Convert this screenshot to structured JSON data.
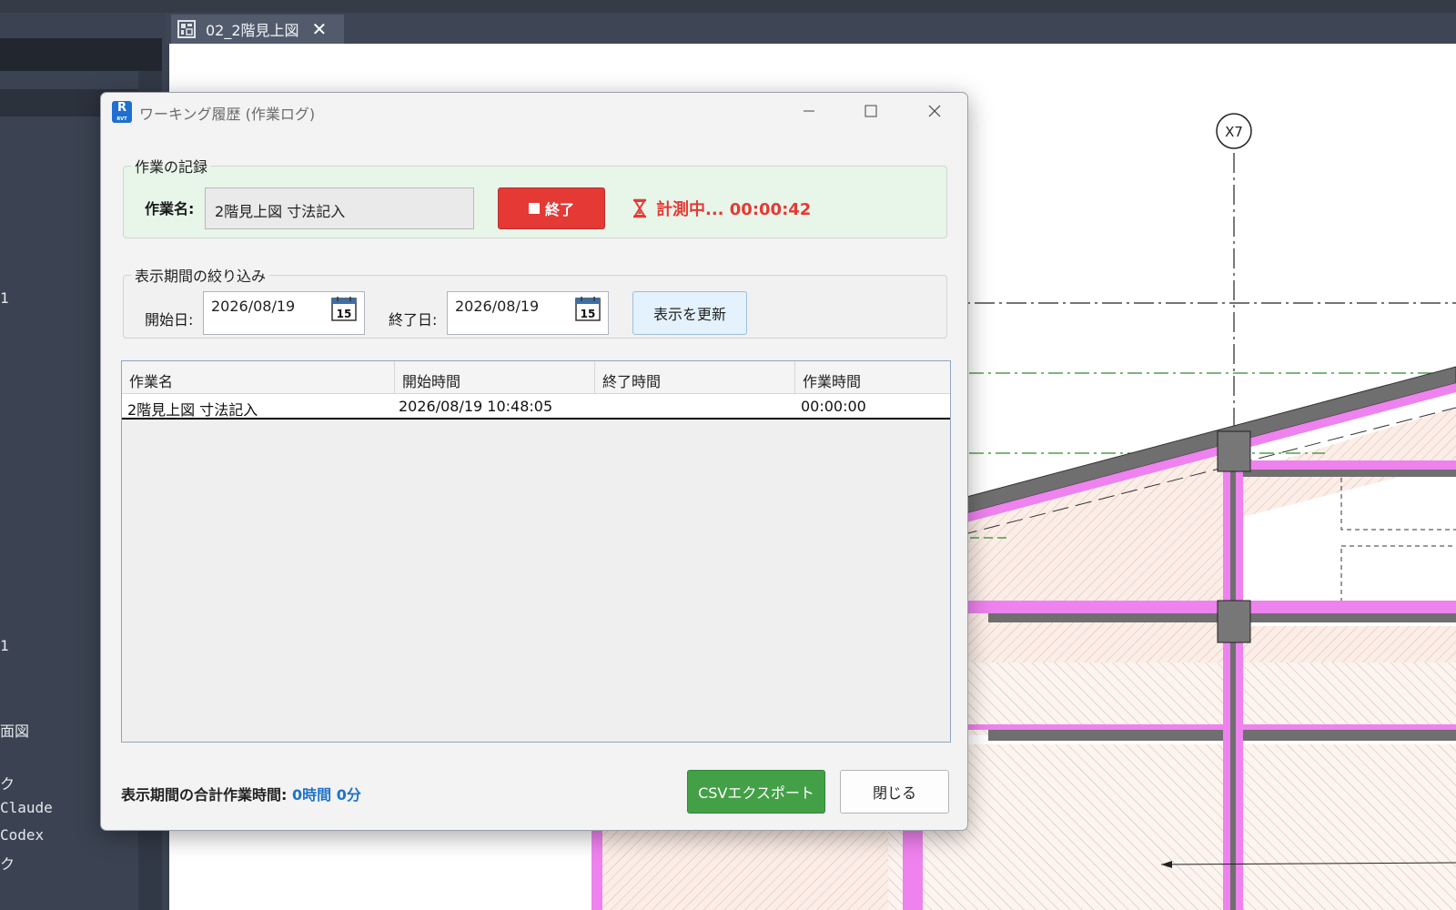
{
  "app": {
    "document_tab": "02_2階見上図",
    "left_panel_items": [
      "1",
      "1",
      "面図",
      "ク",
      "Claude",
      "Codex",
      "ク"
    ],
    "grid_bubble": "X7"
  },
  "dialog": {
    "title": "ワーキング履歴 (作業ログ)",
    "record_group": {
      "legend": "作業の記録",
      "task_label": "作業名:",
      "task_value": "2階見上図 寸法記入",
      "stop_label": "終了",
      "timer_text": "計測中... 00:00:42"
    },
    "filter_group": {
      "legend": "表示期間の絞り込み",
      "start_label": "開始日:",
      "start_date": "2026/08/19",
      "end_label": "終了日:",
      "end_date": "2026/08/19",
      "calendar_day": "15",
      "refresh_label": "表示を更新"
    },
    "table": {
      "columns": [
        "作業名",
        "開始時間",
        "終了時間",
        "作業時間"
      ],
      "rows": [
        [
          "2階見上図 寸法記入",
          "2026/08/19 10:48:05",
          "",
          "00:00:00"
        ]
      ]
    },
    "footer": {
      "total_label": "表示期間の合計作業時間:",
      "total_value": "0時間 0分",
      "csv_label": "CSVエクスポート",
      "close_label": "閉じる"
    }
  },
  "colors": {
    "stop": "#e53935",
    "export": "#43a047",
    "refresh": "#e3f2fd",
    "record_bg": "#e8f5e9",
    "total_value": "#1e74c8"
  }
}
